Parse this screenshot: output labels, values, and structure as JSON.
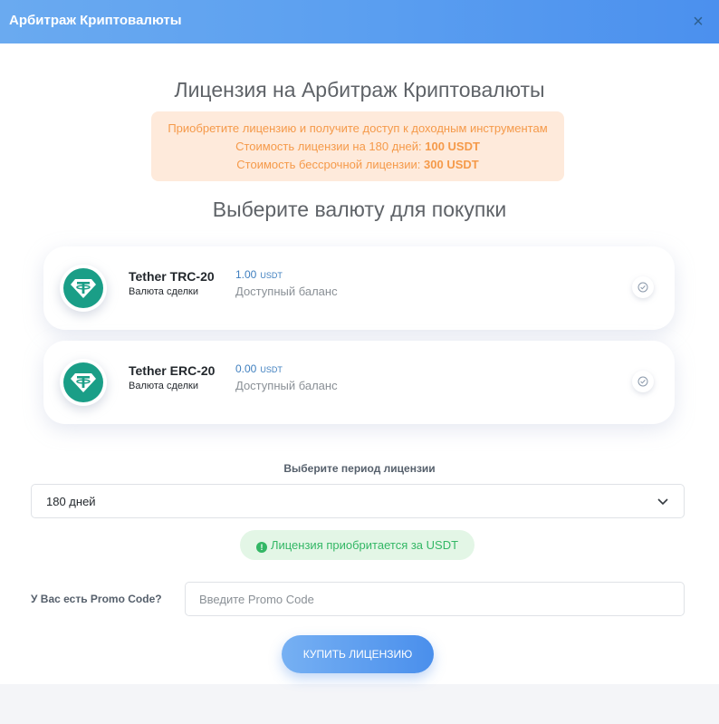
{
  "window": {
    "title": "Арбитраж Криптовалюты",
    "close_symbol": "×"
  },
  "main": {
    "title": "Лицензия на Арбитраж Криптовалюты",
    "notice": {
      "line1": "Приобретите лицензию и получите доступ к доходным инструментам",
      "line2_text": "Стоимость лицензии на 180 дней:",
      "line2_value": "100 USDT",
      "line3_text": "Стоимость бессрочной лицензии:",
      "line3_value": "300 USDT"
    },
    "currency_heading": "Выберите валюту для покупки"
  },
  "currencies": [
    {
      "name": "Tether TRC-20",
      "subtitle": "Валюта сделки",
      "balance": "1.00",
      "unit": "USDT",
      "balance_label": "Доступный баланс",
      "icon": "tether-icon"
    },
    {
      "name": "Tether ERC-20",
      "subtitle": "Валюта сделки",
      "balance": "0.00",
      "unit": "USDT",
      "balance_label": "Доступный баланс",
      "icon": "tether-icon"
    }
  ],
  "period": {
    "label": "Выберите период лицензии",
    "selected": "180 дней"
  },
  "info": {
    "icon_glyph": "!",
    "text": "Лицензия приобритается за USDT"
  },
  "promo": {
    "label": "У Вас есть Promo Code?",
    "placeholder": "Введите Promo Code",
    "value": ""
  },
  "buy_button": "КУПИТЬ ЛИЦЕНЗИЮ",
  "colors": {
    "header": "#5b9ff0",
    "tether": "#1a9e87",
    "notice_bg": "#feeadb",
    "notice_text": "#f59a4a",
    "success": "#33b765",
    "balance": "#3f7fbf"
  }
}
